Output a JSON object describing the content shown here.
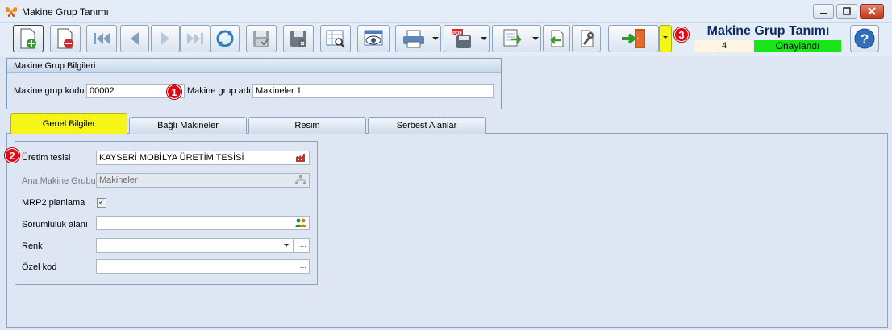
{
  "window": {
    "title": "Makine Grup Tanımı"
  },
  "header": {
    "form_title": "Makine Grup Tanımı",
    "status_number": "4",
    "status_text": "Onaylandı"
  },
  "badges": {
    "one": "1",
    "two": "2",
    "three": "3"
  },
  "group": {
    "title": "Makine Grup Bilgileri",
    "code_label": "Makine grup kodu",
    "code_value": "00002",
    "name_label": "Makine grup adı",
    "name_value": "Makineler 1"
  },
  "tabs": [
    {
      "label": "Genel Bilgiler"
    },
    {
      "label": "Bağlı Makineler"
    },
    {
      "label": "Resim"
    },
    {
      "label": "Serbest Alanlar"
    }
  ],
  "general": {
    "uretim_label": "Üretim tesisi",
    "uretim_value": "KAYSERİ MOBİLYA ÜRETİM TESİSİ",
    "ana_label": "Ana Makine Grubu",
    "ana_value": "Makineler",
    "mrp_label": "MRP2 planlama",
    "mrp_checked": "✓",
    "sorumluluk_label": "Sorumluluk alanı",
    "sorumluluk_value": "",
    "renk_label": "Renk",
    "renk_value": "",
    "ozel_label": "Özel kod",
    "ozel_value": "",
    "ellipsis": "..."
  },
  "colors": {
    "highlight": "#f5f518",
    "approved": "#19e619",
    "badge": "#e30613",
    "title": "#102a5e"
  }
}
